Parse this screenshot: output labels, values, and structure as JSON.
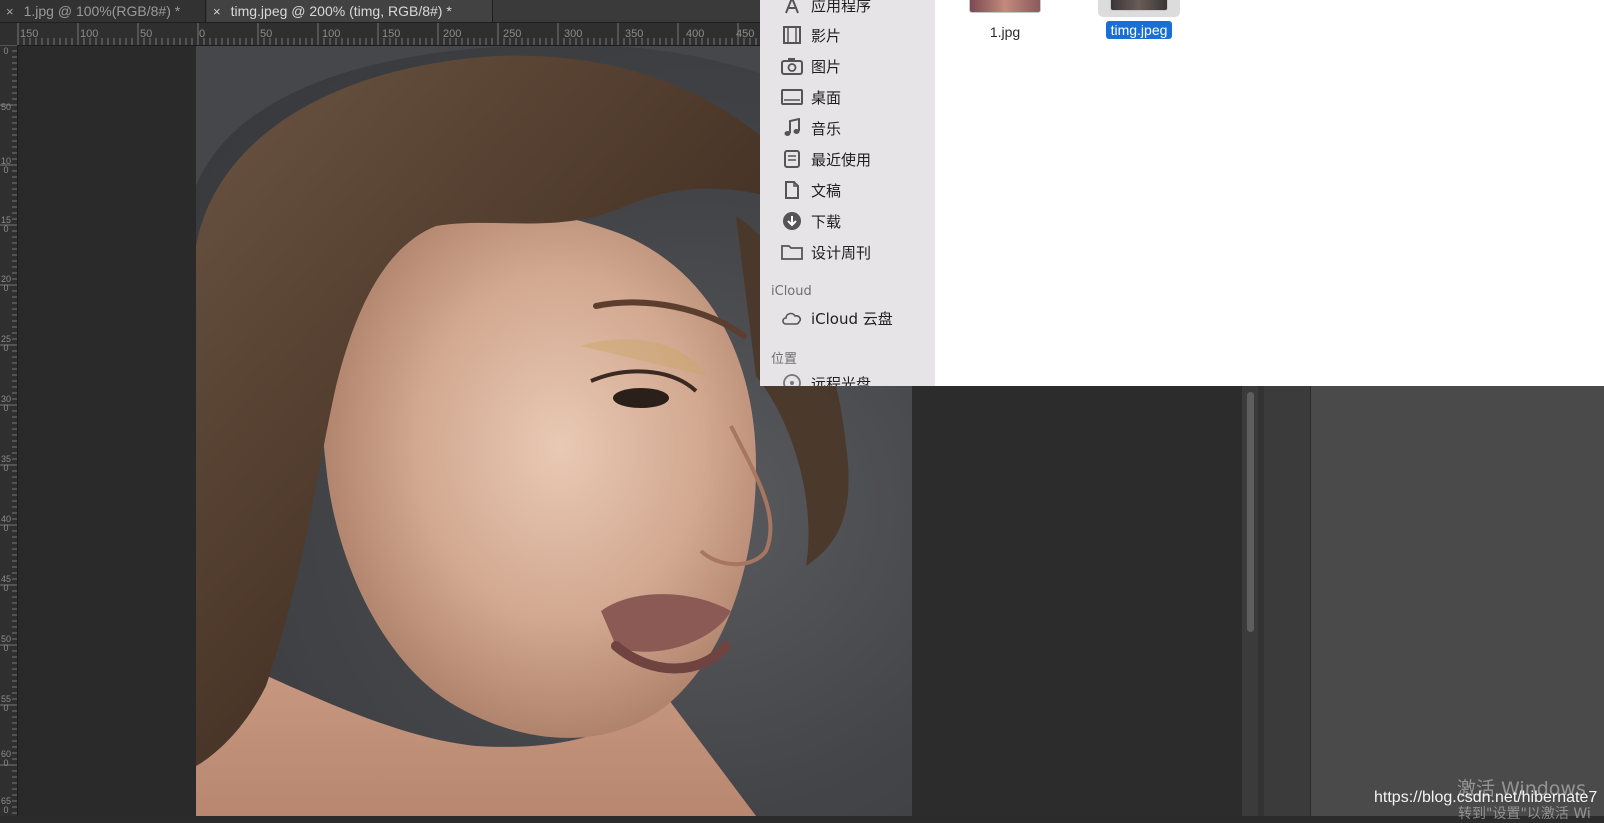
{
  "tabs": [
    {
      "close": "×",
      "label": "1.jpg @ 100%(RGB/8#) *"
    },
    {
      "close": "×",
      "label": "timg.jpeg @ 200% (timg, RGB/8#) *"
    }
  ],
  "ruler": {
    "h_left_labels": [
      "150",
      "100",
      "50"
    ],
    "h_labels": [
      "0",
      "50",
      "100",
      "150",
      "200",
      "250",
      "300",
      "350",
      "400",
      "450"
    ],
    "v_labels": [
      "0",
      "50",
      "100",
      "150",
      "200",
      "250",
      "300",
      "350",
      "400",
      "450",
      "500",
      "550",
      "600",
      "650"
    ]
  },
  "finder": {
    "sidebar": {
      "items": [
        {
          "label": "应用程序",
          "icon": "applications-icon"
        },
        {
          "label": "影片",
          "icon": "film-icon"
        },
        {
          "label": "图片",
          "icon": "camera-icon"
        },
        {
          "label": "桌面",
          "icon": "desktop-icon"
        },
        {
          "label": "音乐",
          "icon": "music-icon"
        },
        {
          "label": "最近使用",
          "icon": "recents-icon"
        },
        {
          "label": "文稿",
          "icon": "documents-icon"
        },
        {
          "label": "下载",
          "icon": "download-icon"
        },
        {
          "label": "设计周刊",
          "icon": "folder-icon"
        }
      ],
      "icloud_header": "iCloud",
      "icloud_item": {
        "label": "iCloud 云盘",
        "icon": "cloud-icon"
      },
      "locations_header": "位置",
      "locations_item": {
        "label": "远程光盘",
        "icon": "disc-icon"
      }
    },
    "files": [
      {
        "name": "1.jpg",
        "selected": false
      },
      {
        "name": "timg.jpeg",
        "selected": true
      }
    ]
  },
  "watermark": {
    "activate": "激活 Windows",
    "url": "https://blog.csdn.net/hibernate7",
    "hint": "转到\"设置\"以激活 Wi"
  },
  "colors": {
    "selection": "#1a6fd4",
    "tab_active": "#424242"
  }
}
